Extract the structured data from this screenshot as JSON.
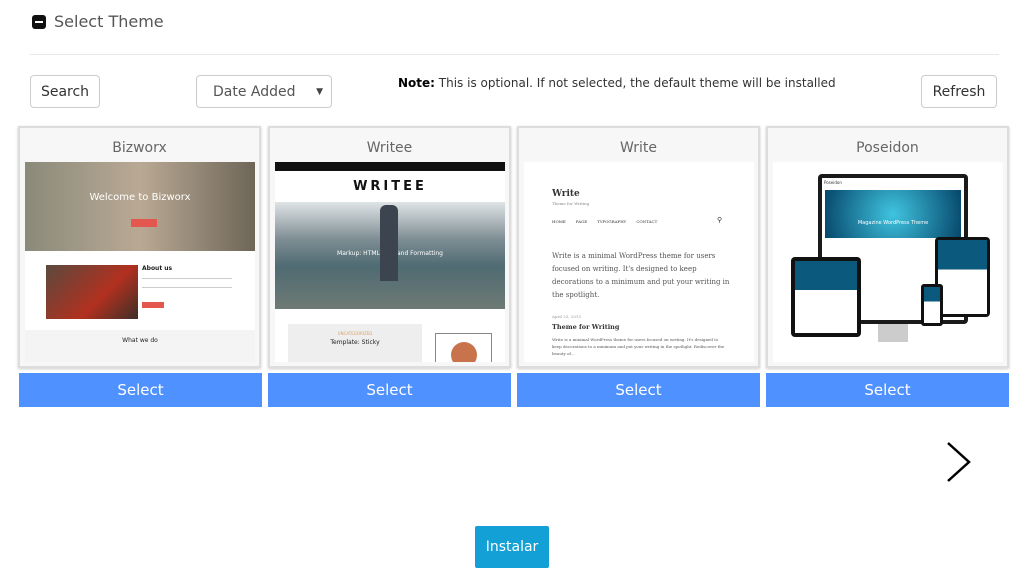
{
  "header": {
    "title": "Select Theme",
    "icon": "collapse-minus-icon"
  },
  "toolbar": {
    "search_label": "Search",
    "sort_value": "Date Added",
    "note_label": "Note:",
    "note_text": " This is optional. If not selected, the default theme will be installed",
    "refresh_label": "Refresh"
  },
  "themes": [
    {
      "name": "Bizworx",
      "select": "Select",
      "preview": {
        "hero": "Welcome to Bizworx",
        "about": "About us",
        "section": "What we do"
      }
    },
    {
      "name": "Writee",
      "select": "Select",
      "preview": {
        "logo": "WRITEE",
        "caption": "Markup: HTML Tags and Formatting",
        "post": "Template: Sticky",
        "category": "UNCATEGORIZED"
      }
    },
    {
      "name": "Write",
      "select": "Select",
      "preview": {
        "site": "Write",
        "tagline": "Theme for Writing",
        "nav": [
          "HOME",
          "PAGE",
          "TYPOGRAPHY",
          "CONTACT"
        ],
        "intro": "Write is a minimal WordPress theme for users focused on writing. It's designed to keep decorations to a minimum and put your writing in the spotlight.",
        "date": "April 23, 2015",
        "post_title": "Theme for Writing",
        "excerpt": "Write is a minimal WordPress theme for users focused on writing. It's designed to keep decorations to a minimum and put your writing in the spotlight. Rediscover the beauty of..."
      }
    },
    {
      "name": "Poseidon",
      "select": "Select",
      "preview": {
        "logo": "Poseidon",
        "hero": "Magazine WordPress Theme"
      }
    }
  ],
  "pager": {
    "next_icon": "chevron-right-icon"
  },
  "install_label": "Instalar",
  "colors": {
    "select": "#4f91ff",
    "install": "#12a0d6"
  }
}
